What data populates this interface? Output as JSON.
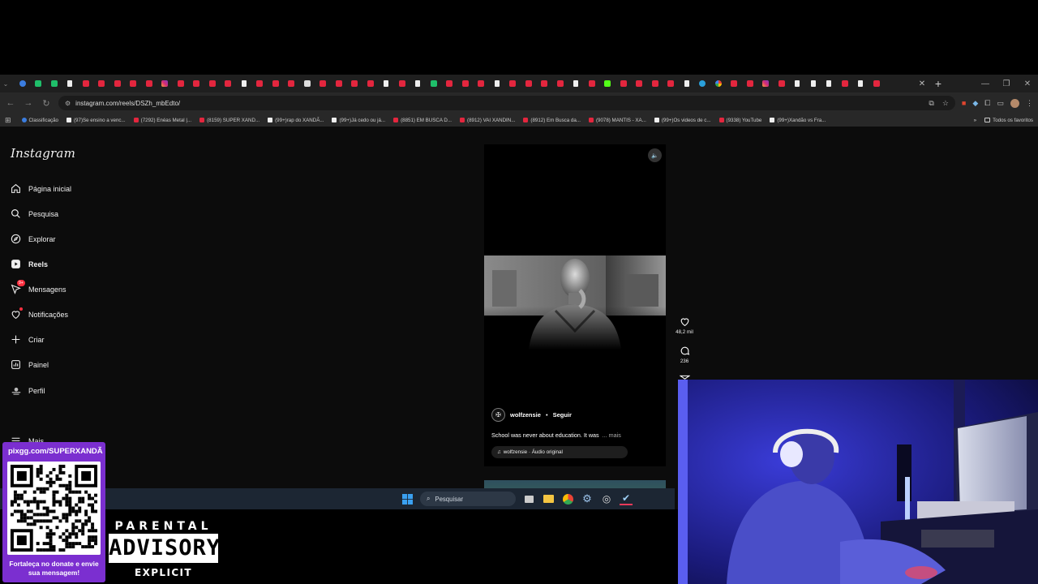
{
  "browser": {
    "url": "instagram.com/reels/DSZh_mbEdto/",
    "tab_favicons": [
      "gen",
      "gr",
      "gr",
      "tt",
      "yt",
      "yt",
      "yt",
      "yt",
      "yt",
      "ig",
      "yt",
      "yt",
      "yt",
      "yt",
      "tt",
      "yt",
      "yt",
      "yt",
      "wh",
      "yt",
      "yt",
      "yt",
      "yt",
      "tt",
      "yt",
      "tt",
      "gr",
      "yt",
      "yt",
      "yt",
      "tt",
      "yt",
      "yt",
      "yt",
      "yt",
      "tt",
      "yt",
      "kk",
      "yt",
      "yt",
      "yt",
      "yt",
      "tt",
      "tg",
      "g",
      "yt",
      "yt",
      "ig",
      "yt",
      "tt",
      "tt",
      "tt",
      "yt",
      "tt",
      "yt"
    ],
    "bookmarks": [
      {
        "label": "Classificação",
        "icon": "gen"
      },
      {
        "label": "(97)Se ensino a venc...",
        "icon": "tt"
      },
      {
        "label": "(7292) Enéas Metal |...",
        "icon": "yt"
      },
      {
        "label": "(8159) SUPER XAND...",
        "icon": "yt"
      },
      {
        "label": "(99+)rap do XANDÃ...",
        "icon": "tt"
      },
      {
        "label": "(99+)Já cedo ou já...",
        "icon": "tt"
      },
      {
        "label": "(8851) EM BUSCA D...",
        "icon": "yt"
      },
      {
        "label": "(8912) VAI XANDIN...",
        "icon": "yt"
      },
      {
        "label": "(8912) Em Busca da...",
        "icon": "yt"
      },
      {
        "label": "(9078) MANTIS - XA...",
        "icon": "yt"
      },
      {
        "label": "(99+)Os videos de c...",
        "icon": "tt"
      },
      {
        "label": "(9338) YouTube",
        "icon": "yt"
      },
      {
        "label": "(99+)Xandão vs Fra...",
        "icon": "tt"
      }
    ],
    "all_bookmarks_label": "Todos os favoritos"
  },
  "instagram": {
    "logo": "Instagram",
    "nav": [
      {
        "label": "Página inicial",
        "icon": "home-icon"
      },
      {
        "label": "Pesquisa",
        "icon": "search-icon"
      },
      {
        "label": "Explorar",
        "icon": "compass-icon"
      },
      {
        "label": "Reels",
        "icon": "reels-icon"
      },
      {
        "label": "Mensagens",
        "icon": "messenger-icon"
      },
      {
        "label": "Notificações",
        "icon": "heart-icon"
      },
      {
        "label": "Criar",
        "icon": "plus-icon"
      },
      {
        "label": "Painel",
        "icon": "dashboard-icon"
      },
      {
        "label": "Perfil",
        "icon": "profile-icon"
      },
      {
        "label": "Mais",
        "icon": "menu-icon"
      }
    ],
    "messages_badge": "9+",
    "reel": {
      "username": "wolfzensie",
      "separator": "•",
      "follow": "Seguir",
      "caption": "School was never about education. It was",
      "more": "... mais",
      "audio": "wolfzensie · Áudio original",
      "likes": "48,2 mil",
      "comments": "236"
    }
  },
  "taskbar": {
    "search_placeholder": "Pesquisar"
  },
  "overlay": {
    "qr_url": "pixgg.com/SUPERXANDÃ",
    "qr_message": "Fortaleça no donate e envie sua mensagem!",
    "pa_top": "PARENTAL",
    "pa_mid": "ADVISORY",
    "pa_bot": "EXPLICIT CONTENT"
  },
  "colors": {
    "ig_bg": "#0c0c0c",
    "qr_purple": "#7b2fd0",
    "notify_red": "#ff3040",
    "taskbar": "#1c2633"
  }
}
